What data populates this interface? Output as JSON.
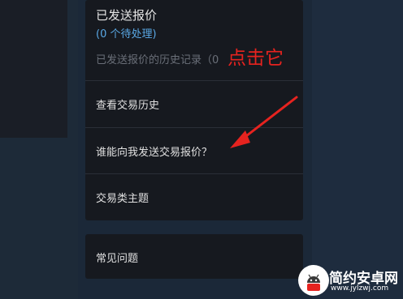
{
  "sent_offers": {
    "title": "已发送报价",
    "pending": "(0 个待处理)",
    "history_link": "已发送报价的历史记录（0"
  },
  "menu": {
    "items": [
      {
        "label": "查看交易历史"
      },
      {
        "label": "谁能向我发送交易报价？"
      },
      {
        "label": "交易类主题"
      }
    ],
    "faq": "常见问题"
  },
  "annotation": {
    "text": "点击它",
    "color": "#e6231f"
  },
  "watermark": {
    "brand": "简约安卓网",
    "url": "www.jylzwj.com",
    "icon": "android-robot-icon"
  },
  "colors": {
    "page_bg": "#1b2838",
    "card_bg": "#16191f",
    "link_blue": "#5aa9e6"
  }
}
